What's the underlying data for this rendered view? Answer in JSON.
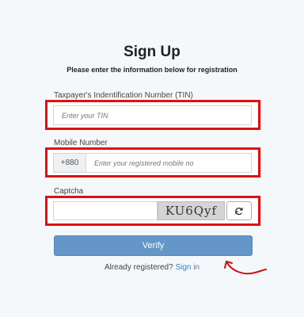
{
  "header": {
    "title": "Sign Up",
    "subtitle": "Please enter the information below for registration"
  },
  "tin": {
    "label": "Taxpayer's Indentification Number (TIN)",
    "placeholder": "Enter your TIN"
  },
  "mobile": {
    "label": "Mobile Number",
    "prefix": "+880",
    "placeholder": "Enter your registered mobile no"
  },
  "captcha": {
    "label": "Captcha",
    "code": "KU6Qyf",
    "refresh_icon": "refresh-icon"
  },
  "verify_label": "Verify",
  "footer": {
    "text": "Already registered?",
    "link": "Sign in"
  },
  "colors": {
    "highlight": "#e01010",
    "button": "#6496c8",
    "link": "#3b7fc4"
  }
}
